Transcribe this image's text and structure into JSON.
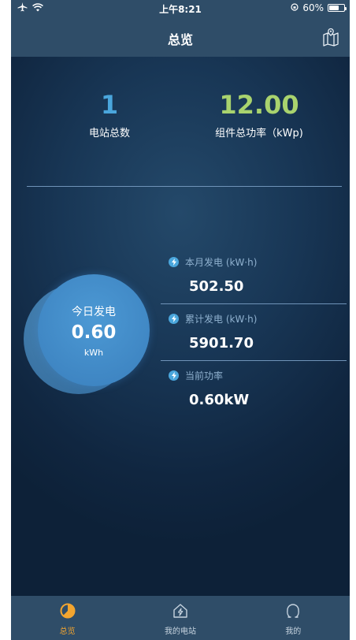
{
  "status_bar": {
    "time": "上午8:21",
    "battery_text": "60%",
    "battery_level": 0.6
  },
  "header": {
    "title": "总览"
  },
  "stats": {
    "station_count": {
      "value": "1",
      "label": "电站总数"
    },
    "total_power": {
      "value": "12.00",
      "label": "组件总功率（kWp)"
    }
  },
  "today": {
    "label": "今日发电",
    "value": "0.60",
    "unit": "kWh"
  },
  "metrics": [
    {
      "label": "本月发电 (kW·h)",
      "value": "502.50"
    },
    {
      "label": "累计发电 (kW·h)",
      "value": "5901.70"
    },
    {
      "label": "当前功率",
      "value": "0.60kW"
    }
  ],
  "tabs": [
    {
      "label": "总览",
      "icon": "pie-chart-icon",
      "active": true
    },
    {
      "label": "我的电站",
      "icon": "house-bolt-icon",
      "active": false
    },
    {
      "label": "我的",
      "icon": "user-icon",
      "active": false
    }
  ],
  "colors": {
    "accent_blue": "#4aa6dc",
    "accent_green": "#a9d36e",
    "tab_active": "#f3a52f",
    "bar_bg": "#2f4d68"
  }
}
